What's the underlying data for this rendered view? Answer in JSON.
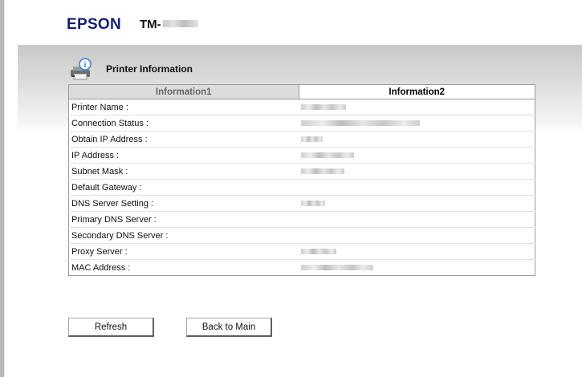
{
  "header": {
    "brand": "EPSON",
    "model_prefix": "TM-"
  },
  "section": {
    "title": "Printer Information",
    "icon": "printer-info-icon"
  },
  "tabs": [
    {
      "label": "Information1",
      "active": false
    },
    {
      "label": "Information2",
      "active": true
    }
  ],
  "rows": [
    {
      "label": "Printer Name :",
      "value_redacted": true
    },
    {
      "label": "Connection Status :",
      "value_redacted": true
    },
    {
      "label": "Obtain IP Address :",
      "value_redacted": true
    },
    {
      "label": "IP Address :",
      "value_redacted": true
    },
    {
      "label": "Subnet Mask :",
      "value_redacted": true
    },
    {
      "label": "Default Gateway :",
      "value_redacted": false
    },
    {
      "label": "DNS Server Setting :",
      "value_redacted": true
    },
    {
      "label": "Primary DNS Server :",
      "value_redacted": false
    },
    {
      "label": "Secondary DNS Server :",
      "value_redacted": false
    },
    {
      "label": "Proxy Server :",
      "value_redacted": true
    },
    {
      "label": "MAC Address :",
      "value_redacted": true
    }
  ],
  "buttons": {
    "refresh": "Refresh",
    "back": "Back to Main"
  },
  "colors": {
    "brand": "#101e7a",
    "inactive_tab": "#dcdcdc"
  }
}
